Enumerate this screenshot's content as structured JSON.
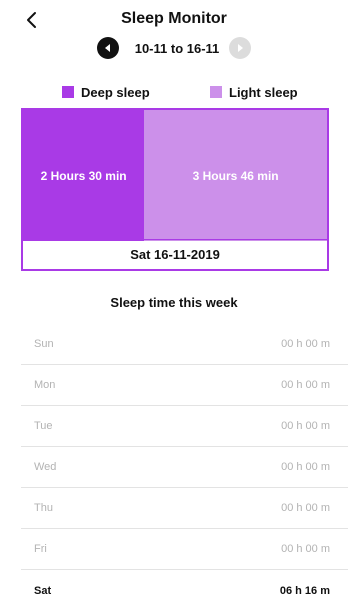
{
  "header": {
    "title": "Sleep Monitor"
  },
  "date_nav": {
    "range": "10-11 to 16-11"
  },
  "legend": {
    "deep_label": "Deep sleep",
    "light_label": "Light sleep",
    "deep_color": "#a93ae6",
    "light_color": "#cc90ea"
  },
  "sleep_bar": {
    "deep_text": "2 Hours 30 min",
    "light_text": "3 Hours 46 min",
    "deep_minutes": 150,
    "light_minutes": 226,
    "date": "Sat 16-11-2019"
  },
  "week": {
    "title": "Sleep time this week",
    "days": [
      {
        "day": "Sun",
        "time": "00 h 00 m",
        "current": false
      },
      {
        "day": "Mon",
        "time": "00 h 00 m",
        "current": false
      },
      {
        "day": "Tue",
        "time": "00 h 00 m",
        "current": false
      },
      {
        "day": "Wed",
        "time": "00 h 00 m",
        "current": false
      },
      {
        "day": "Thu",
        "time": "00 h 00 m",
        "current": false
      },
      {
        "day": "Fri",
        "time": "00 h 00 m",
        "current": false
      },
      {
        "day": "Sat",
        "time": "06 h 16 m",
        "current": true
      }
    ]
  },
  "icons": {
    "back": "chevron-left-icon",
    "prev": "caret-left-icon",
    "next": "caret-right-icon"
  }
}
